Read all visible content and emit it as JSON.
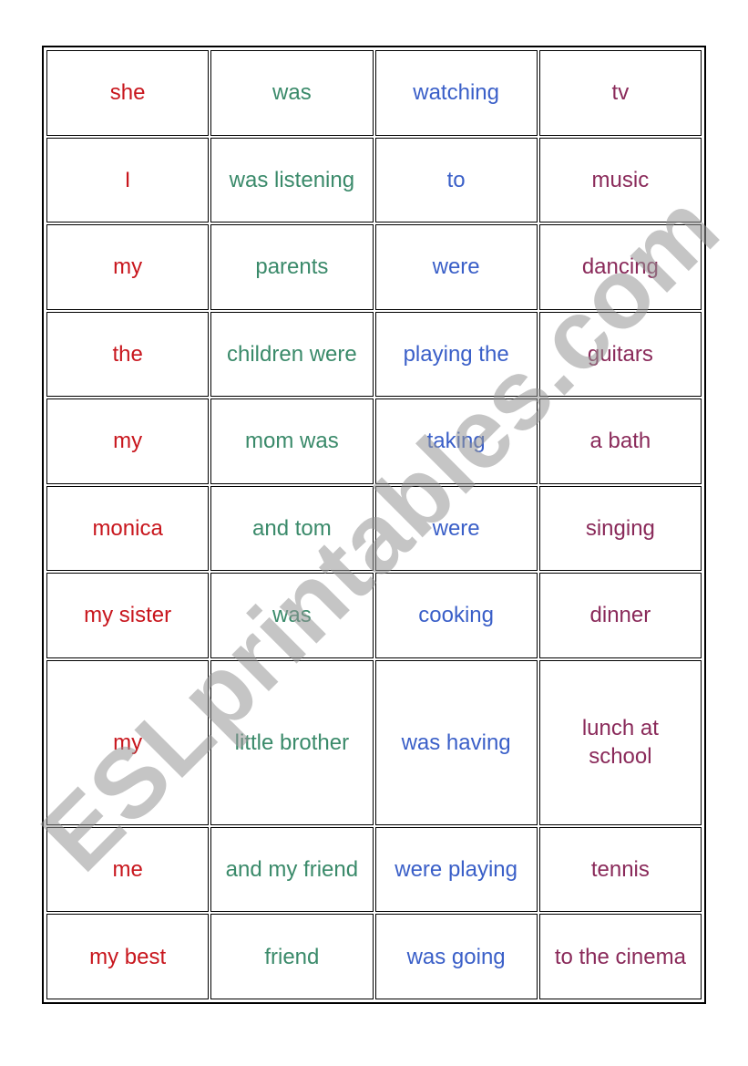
{
  "colors": {
    "subject": "#c8161d",
    "verb_part": "#3a8a6a",
    "verb": "#3a5fc8",
    "object": "#8a2a5a"
  },
  "watermark": "ESLprintables.com",
  "rows": [
    [
      "she",
      "was",
      "watching",
      "tv"
    ],
    [
      "I",
      "was listening",
      "to",
      "music"
    ],
    [
      "my",
      "parents",
      "were",
      "dancing"
    ],
    [
      "the",
      "children were",
      "playing the",
      "guitars"
    ],
    [
      "my",
      "mom was",
      "taking",
      "a bath"
    ],
    [
      "monica",
      "and tom",
      "were",
      "singing"
    ],
    [
      "my sister",
      "was",
      "cooking",
      "dinner"
    ],
    [
      "my",
      "little brother",
      "was having",
      "lunch at school"
    ],
    [
      "me",
      "and my friend",
      "were playing",
      "tennis"
    ],
    [
      "my best",
      "friend",
      "was going",
      "to the cinema"
    ]
  ]
}
